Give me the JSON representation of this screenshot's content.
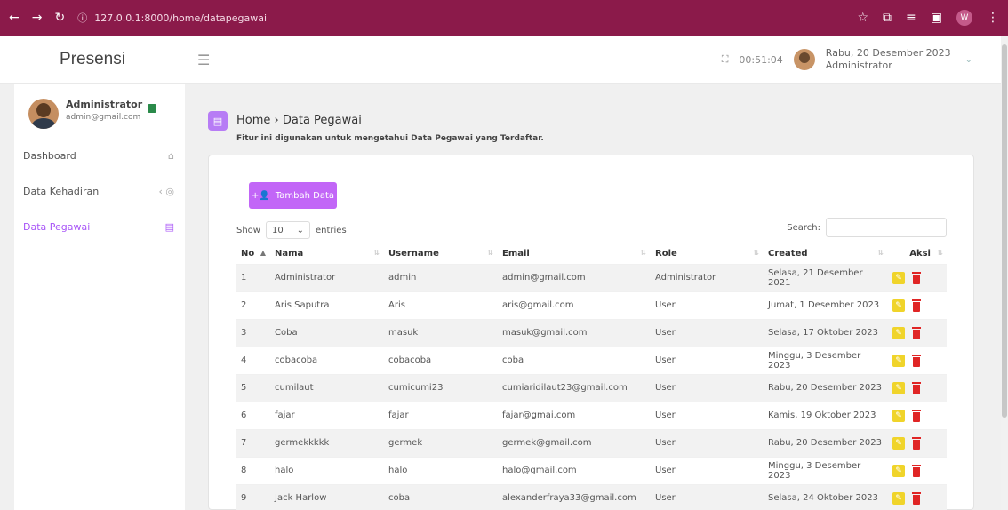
{
  "browser": {
    "url": "127.0.0.1:8000/home/datapegawai",
    "profile_initial": "W"
  },
  "header": {
    "brand": "Presensi",
    "time": "00:51:04",
    "date": "Rabu, 20 Desember 2023",
    "role": "Administrator"
  },
  "sidebar": {
    "profile_name": "Administrator",
    "profile_email": "admin@gmail.com",
    "items": [
      {
        "label": "Dashboard"
      },
      {
        "label": "Data Kehadiran"
      },
      {
        "label": "Data Pegawai"
      }
    ]
  },
  "page": {
    "breadcrumb_home": "Home",
    "breadcrumb_sep": "›",
    "breadcrumb_current": "Data Pegawai",
    "subtitle": "Fitur ini digunakan untuk mengetahui Data Pegawai yang Terdaftar.",
    "add_button": "Tambah Data",
    "show_label": "Show",
    "entries_value": "10",
    "entries_label": "entries",
    "search_label": "Search:"
  },
  "table": {
    "headers": [
      "No",
      "Nama",
      "Username",
      "Email",
      "Role",
      "Created",
      "Aksi"
    ],
    "rows": [
      [
        "1",
        "Administrator",
        "admin",
        "admin@gmail.com",
        "Administrator",
        "Selasa, 21 Desember 2021"
      ],
      [
        "2",
        "Aris Saputra",
        "Aris",
        "aris@gmail.com",
        "User",
        "Jumat, 1 Desember 2023"
      ],
      [
        "3",
        "Coba",
        "masuk",
        "masuk@gmail.com",
        "User",
        "Selasa, 17 Oktober 2023"
      ],
      [
        "4",
        "cobacoba",
        "cobacoba",
        "coba",
        "User",
        "Minggu, 3 Desember 2023"
      ],
      [
        "5",
        "cumilaut",
        "cumicumi23",
        "cumiaridilaut23@gmail.com",
        "User",
        "Rabu, 20 Desember 2023"
      ],
      [
        "6",
        "fajar",
        "fajar",
        "fajar@gmai.com",
        "User",
        "Kamis, 19 Oktober 2023"
      ],
      [
        "7",
        "germekkkkk",
        "germek",
        "germek@gmail.com",
        "User",
        "Rabu, 20 Desember 2023"
      ],
      [
        "8",
        "halo",
        "halo",
        "halo@gmail.com",
        "User",
        "Minggu, 3 Desember 2023"
      ],
      [
        "9",
        "Jack Harlow",
        "coba",
        "alexanderfraya33@gmail.com",
        "User",
        "Selasa, 24 Oktober 2023"
      ]
    ]
  },
  "colors": {
    "browser_bar": "#8b1a4a",
    "accent": "#a855f7",
    "button": "#c266f7",
    "edit": "#f0d42a",
    "delete": "#e02525"
  }
}
